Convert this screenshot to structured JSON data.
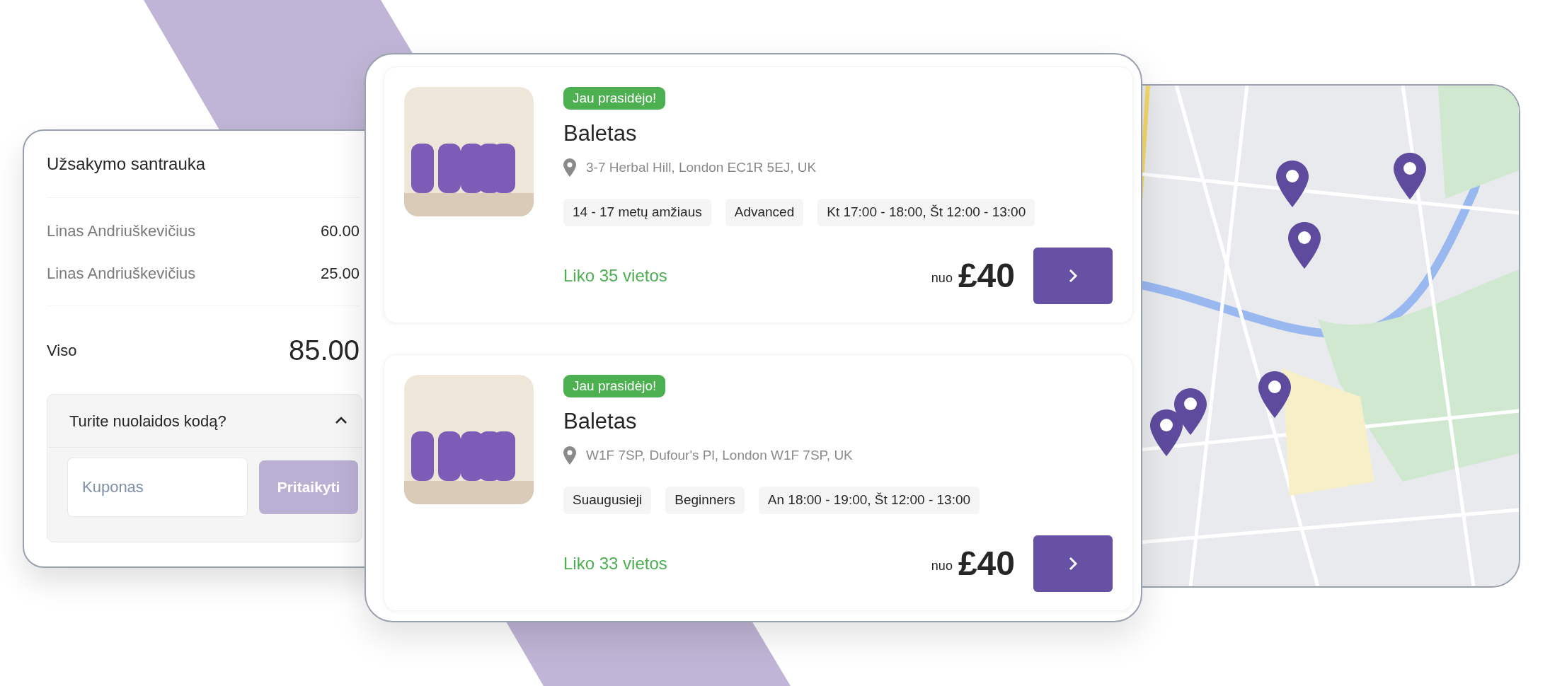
{
  "order_summary": {
    "title": "Užsakymo santrauka",
    "items": [
      {
        "name": "Linas Andriuškevičius",
        "amount": "60.00"
      },
      {
        "name": "Linas Andriuškevičius",
        "amount": "25.00"
      }
    ],
    "total_label": "Viso",
    "total": "85.00",
    "coupon": {
      "title": "Turite nuolaidos kodą?",
      "expanded": true,
      "placeholder": "Kuponas",
      "button": "Pritaikyti",
      "button_disabled": true
    }
  },
  "classes": [
    {
      "badge": "Jau prasidėjo!",
      "title": "Baletas",
      "address": "3-7 Herbal Hill, London EC1R 5EJ, UK",
      "tags": [
        "14 - 17 metų amžiaus",
        "Advanced",
        "Kt 17:00 - 18:00, Št 12:00 - 13:00"
      ],
      "availability": "Liko 35 vietos",
      "price_prefix": "nuo",
      "price": "£40"
    },
    {
      "badge": "Jau prasidėjo!",
      "title": "Baletas",
      "address": "W1F 7SP, Dufour's Pl, London W1F 7SP, UK",
      "tags": [
        "Suaugusieji",
        "Beginners",
        "An 18:00 - 19:00, Št 12:00 - 13:00"
      ],
      "availability": "Liko 33 vietos",
      "price_prefix": "nuo",
      "price": "£40"
    }
  ]
}
